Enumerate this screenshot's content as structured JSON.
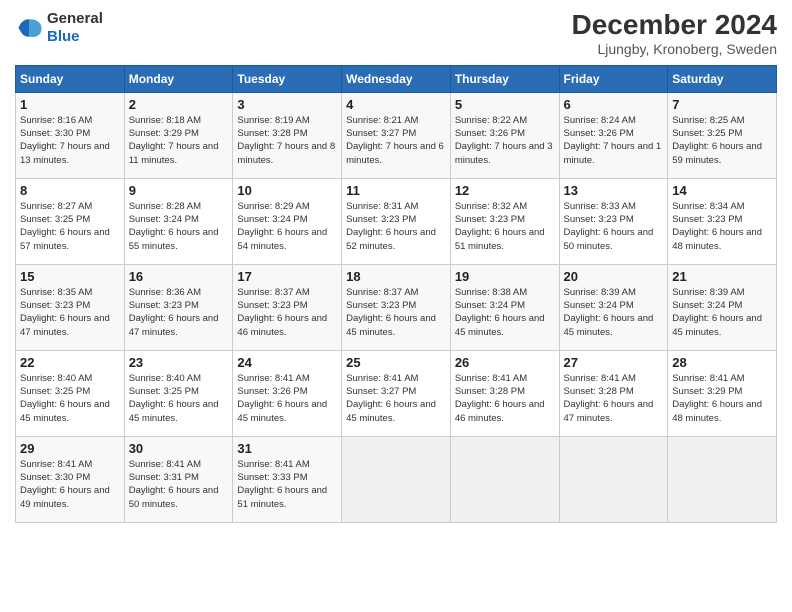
{
  "logo": {
    "line1": "General",
    "line2": "Blue"
  },
  "title": "December 2024",
  "subtitle": "Ljungby, Kronoberg, Sweden",
  "days_of_week": [
    "Sunday",
    "Monday",
    "Tuesday",
    "Wednesday",
    "Thursday",
    "Friday",
    "Saturday"
  ],
  "weeks": [
    [
      {
        "day": 1,
        "sunrise": "8:16 AM",
        "sunset": "3:30 PM",
        "daylight": "7 hours and 13 minutes."
      },
      {
        "day": 2,
        "sunrise": "8:18 AM",
        "sunset": "3:29 PM",
        "daylight": "7 hours and 11 minutes."
      },
      {
        "day": 3,
        "sunrise": "8:19 AM",
        "sunset": "3:28 PM",
        "daylight": "7 hours and 8 minutes."
      },
      {
        "day": 4,
        "sunrise": "8:21 AM",
        "sunset": "3:27 PM",
        "daylight": "7 hours and 6 minutes."
      },
      {
        "day": 5,
        "sunrise": "8:22 AM",
        "sunset": "3:26 PM",
        "daylight": "7 hours and 3 minutes."
      },
      {
        "day": 6,
        "sunrise": "8:24 AM",
        "sunset": "3:26 PM",
        "daylight": "7 hours and 1 minute."
      },
      {
        "day": 7,
        "sunrise": "8:25 AM",
        "sunset": "3:25 PM",
        "daylight": "6 hours and 59 minutes."
      }
    ],
    [
      {
        "day": 8,
        "sunrise": "8:27 AM",
        "sunset": "3:25 PM",
        "daylight": "6 hours and 57 minutes."
      },
      {
        "day": 9,
        "sunrise": "8:28 AM",
        "sunset": "3:24 PM",
        "daylight": "6 hours and 55 minutes."
      },
      {
        "day": 10,
        "sunrise": "8:29 AM",
        "sunset": "3:24 PM",
        "daylight": "6 hours and 54 minutes."
      },
      {
        "day": 11,
        "sunrise": "8:31 AM",
        "sunset": "3:23 PM",
        "daylight": "6 hours and 52 minutes."
      },
      {
        "day": 12,
        "sunrise": "8:32 AM",
        "sunset": "3:23 PM",
        "daylight": "6 hours and 51 minutes."
      },
      {
        "day": 13,
        "sunrise": "8:33 AM",
        "sunset": "3:23 PM",
        "daylight": "6 hours and 50 minutes."
      },
      {
        "day": 14,
        "sunrise": "8:34 AM",
        "sunset": "3:23 PM",
        "daylight": "6 hours and 48 minutes."
      }
    ],
    [
      {
        "day": 15,
        "sunrise": "8:35 AM",
        "sunset": "3:23 PM",
        "daylight": "6 hours and 47 minutes."
      },
      {
        "day": 16,
        "sunrise": "8:36 AM",
        "sunset": "3:23 PM",
        "daylight": "6 hours and 47 minutes."
      },
      {
        "day": 17,
        "sunrise": "8:37 AM",
        "sunset": "3:23 PM",
        "daylight": "6 hours and 46 minutes."
      },
      {
        "day": 18,
        "sunrise": "8:37 AM",
        "sunset": "3:23 PM",
        "daylight": "6 hours and 45 minutes."
      },
      {
        "day": 19,
        "sunrise": "8:38 AM",
        "sunset": "3:24 PM",
        "daylight": "6 hours and 45 minutes."
      },
      {
        "day": 20,
        "sunrise": "8:39 AM",
        "sunset": "3:24 PM",
        "daylight": "6 hours and 45 minutes."
      },
      {
        "day": 21,
        "sunrise": "8:39 AM",
        "sunset": "3:24 PM",
        "daylight": "6 hours and 45 minutes."
      }
    ],
    [
      {
        "day": 22,
        "sunrise": "8:40 AM",
        "sunset": "3:25 PM",
        "daylight": "6 hours and 45 minutes."
      },
      {
        "day": 23,
        "sunrise": "8:40 AM",
        "sunset": "3:25 PM",
        "daylight": "6 hours and 45 minutes."
      },
      {
        "day": 24,
        "sunrise": "8:41 AM",
        "sunset": "3:26 PM",
        "daylight": "6 hours and 45 minutes."
      },
      {
        "day": 25,
        "sunrise": "8:41 AM",
        "sunset": "3:27 PM",
        "daylight": "6 hours and 45 minutes."
      },
      {
        "day": 26,
        "sunrise": "8:41 AM",
        "sunset": "3:28 PM",
        "daylight": "6 hours and 46 minutes."
      },
      {
        "day": 27,
        "sunrise": "8:41 AM",
        "sunset": "3:28 PM",
        "daylight": "6 hours and 47 minutes."
      },
      {
        "day": 28,
        "sunrise": "8:41 AM",
        "sunset": "3:29 PM",
        "daylight": "6 hours and 48 minutes."
      }
    ],
    [
      {
        "day": 29,
        "sunrise": "8:41 AM",
        "sunset": "3:30 PM",
        "daylight": "6 hours and 49 minutes."
      },
      {
        "day": 30,
        "sunrise": "8:41 AM",
        "sunset": "3:31 PM",
        "daylight": "6 hours and 50 minutes."
      },
      {
        "day": 31,
        "sunrise": "8:41 AM",
        "sunset": "3:33 PM",
        "daylight": "6 hours and 51 minutes."
      },
      null,
      null,
      null,
      null
    ]
  ]
}
